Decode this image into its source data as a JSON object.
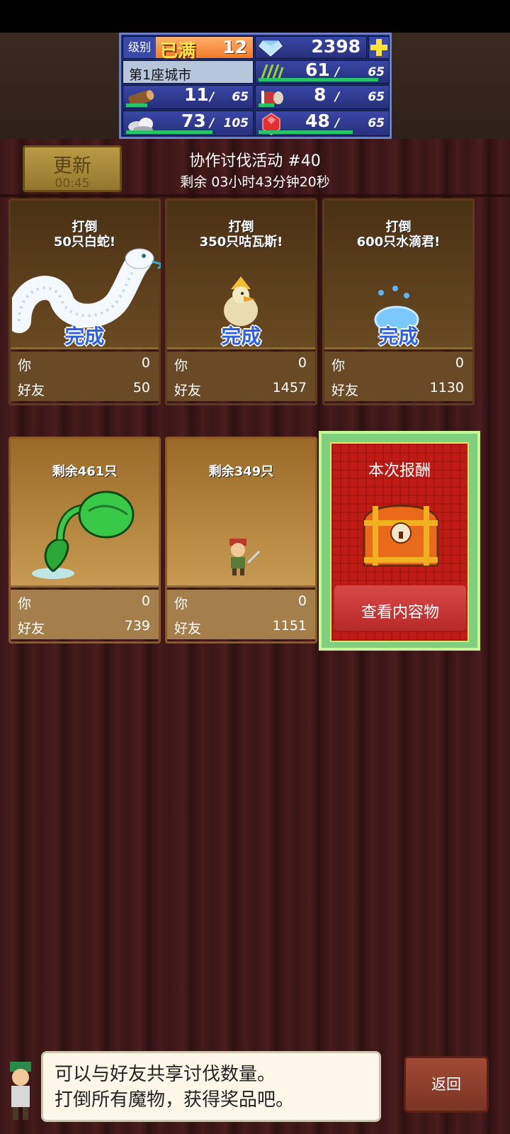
{
  "hud": {
    "level_label": "级别",
    "level_status": "已满",
    "level_value": "12",
    "gems": "2398",
    "city_name": "第1座城市",
    "resources": [
      {
        "icon": "wood-log-icon",
        "value": "11",
        "max": "65",
        "fill": 0.17
      },
      {
        "icon": "grass-bundle-icon",
        "value": "61",
        "max": "65",
        "fill": 0.94
      },
      {
        "icon": "food-meat-icon",
        "value": "8",
        "max": "65",
        "fill": 0.12
      },
      {
        "icon": "stone-ore-icon",
        "value": "73",
        "max": "105",
        "fill": 0.7
      },
      {
        "icon": "red-crystal-icon",
        "value": "48",
        "max": "65",
        "fill": 0.74
      }
    ]
  },
  "event": {
    "refresh_label": "更新",
    "refresh_timer": "00:45",
    "title": "协作讨伐活动 #40",
    "remaining": "剩余 03小时43分钟20秒"
  },
  "cards": [
    {
      "goal_line1": "打倒",
      "goal_line2": "50只白蛇!",
      "done": "完成",
      "monster": "white-serpent-icon",
      "you_label": "你",
      "you_value": "0",
      "friend_label": "好友",
      "friend_value": "50"
    },
    {
      "goal_line1": "打倒",
      "goal_line2": "350只咕瓦斯!",
      "done": "完成",
      "monster": "chicken-knight-icon",
      "you_label": "你",
      "you_value": "0",
      "friend_label": "好友",
      "friend_value": "1457"
    },
    {
      "goal_line1": "打倒",
      "goal_line2": "600只水滴君!",
      "done": "完成",
      "monster": "water-slime-icon",
      "you_label": "你",
      "you_value": "0",
      "friend_label": "好友",
      "friend_value": "1130"
    },
    {
      "goal_line1": "剩余461只",
      "monster": "green-plant-icon",
      "you_label": "你",
      "you_value": "0",
      "friend_label": "好友",
      "friend_value": "739"
    },
    {
      "goal_line1": "剩余349只",
      "monster": "bandit-warrior-icon",
      "you_label": "你",
      "you_value": "0",
      "friend_label": "好友",
      "friend_value": "1151"
    }
  ],
  "reward": {
    "title": "本次报酬",
    "button": "查看内容物",
    "icon": "treasure-chest-icon"
  },
  "tip": {
    "line1": "可以与好友共享讨伐数量。",
    "line2": "打倒所有魔物，获得奖品吧。"
  },
  "back_label": "返回",
  "colors": {
    "done_text": "#2a5fe8",
    "progress_bar": "#27c469",
    "reward_frame": "#7fd07c",
    "reward_bg": "#c11b16"
  }
}
